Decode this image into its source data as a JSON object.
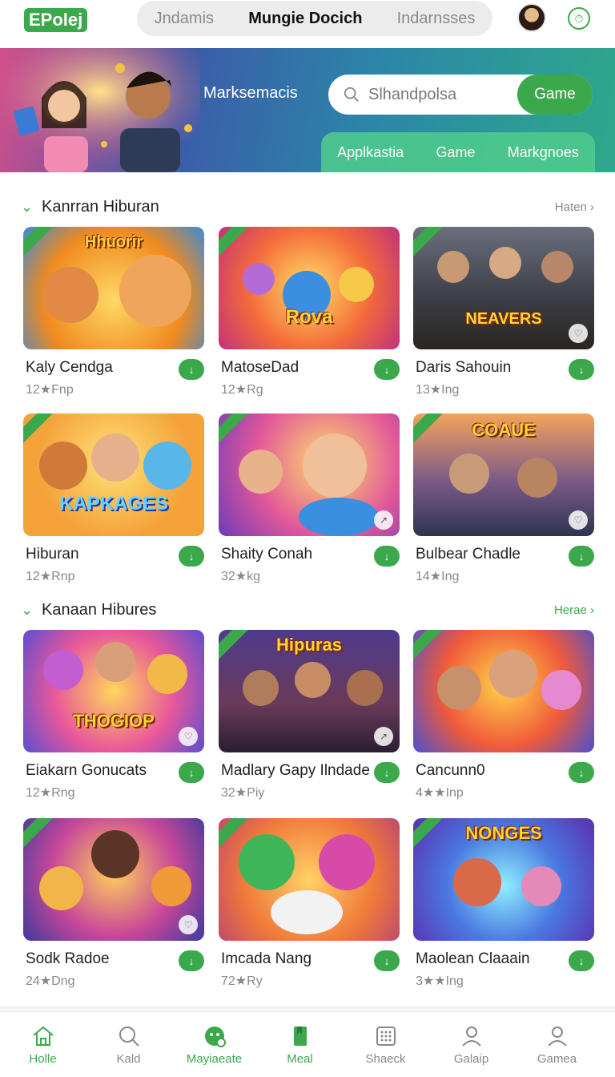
{
  "header": {
    "logo": "EPolej",
    "tabs": [
      {
        "label": "Jndamis",
        "active": false
      },
      {
        "label": "Mungie Docich",
        "active": true
      },
      {
        "label": "Indarnsses",
        "active": false
      }
    ]
  },
  "hero": {
    "title": "Marksemacis",
    "search_placeholder": "Slhandpolsa",
    "search_button": "Game",
    "tabs": [
      "Applkastia",
      "Game",
      "Markgnoes"
    ]
  },
  "sections": [
    {
      "title": "Kanrran Hiburan",
      "more": "Haten",
      "items": [
        {
          "name": "Kaly Cendga",
          "sub": "12★Fnp",
          "art": "Hhuorir"
        },
        {
          "name": "MatoseDad",
          "sub": "12★Rg",
          "art": "Rova"
        },
        {
          "name": "Daris Sahouin",
          "sub": "13★Ing",
          "art": "NEAVERS"
        },
        {
          "name": "Hiburan",
          "sub": "12★Rnp",
          "art": "KAPKAGES"
        },
        {
          "name": "Shaity Conah",
          "sub": "32★kg",
          "art": ""
        },
        {
          "name": "Bulbear Chadle",
          "sub": "14★Ing",
          "art": "COAUE"
        }
      ]
    },
    {
      "title": "Kanaan Hibures",
      "more": "Herae",
      "items": [
        {
          "name": "Eiakarn Gonucats",
          "sub": "12★Rng",
          "art": "THOGIOP"
        },
        {
          "name": "Madlary Gapy Ilndade",
          "sub": "32★Piy",
          "art": "Hipuras"
        },
        {
          "name": "Cancunn0",
          "sub": "4★★Inp",
          "art": ""
        },
        {
          "name": "Sodk Radoe",
          "sub": "24★Dng",
          "art": ""
        },
        {
          "name": "Imcada Nang",
          "sub": "72★Ry",
          "art": ""
        },
        {
          "name": "Maolean Claaain",
          "sub": "3★★Ing",
          "art": "NONGES"
        }
      ]
    }
  ],
  "bottom_nav": [
    {
      "label": "Holle",
      "icon": "home-icon",
      "active": true
    },
    {
      "label": "Kald",
      "icon": "search-icon",
      "active": false
    },
    {
      "label": "Mayiaeate",
      "icon": "games-icon",
      "active": true
    },
    {
      "label": "Meal",
      "icon": "bookmark-icon",
      "active": true
    },
    {
      "label": "Shaeck",
      "icon": "grid-icon",
      "active": false
    },
    {
      "label": "Galaip",
      "icon": "profile-icon",
      "active": false
    },
    {
      "label": "Gamea",
      "icon": "user-icon",
      "active": false
    }
  ],
  "colors": {
    "accent": "#3aa84b"
  }
}
